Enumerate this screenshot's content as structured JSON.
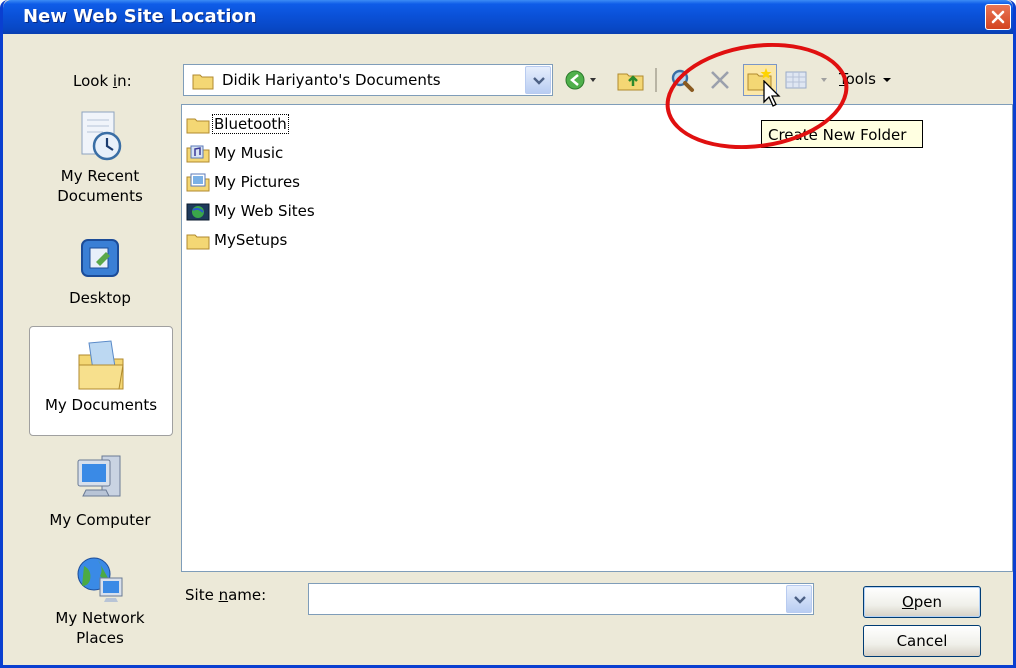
{
  "window": {
    "title": "New Web Site Location"
  },
  "lookin": {
    "label_pre": "Look ",
    "label_accel": "i",
    "label_post": "n:",
    "value": "Didik Hariyanto's Documents"
  },
  "toolbar": {
    "tools_pre": "",
    "tools_accel": "T",
    "tools_post": "ools"
  },
  "places": [
    {
      "label": "My Recent Documents",
      "icon": "recent-documents-icon"
    },
    {
      "label": "Desktop",
      "icon": "desktop-icon"
    },
    {
      "label": "My Documents",
      "icon": "my-documents-icon",
      "selected": true
    },
    {
      "label": "My Computer",
      "icon": "my-computer-icon"
    },
    {
      "label": "My Network Places",
      "icon": "network-places-icon"
    }
  ],
  "files": [
    {
      "name": "Bluetooth",
      "icon": "folder-icon"
    },
    {
      "name": "My Music",
      "icon": "music-folder-icon"
    },
    {
      "name": "My Pictures",
      "icon": "pictures-folder-icon"
    },
    {
      "name": "My Web Sites",
      "icon": "web-sites-folder-icon"
    },
    {
      "name": "MySetups",
      "icon": "folder-icon"
    }
  ],
  "tooltip": {
    "text": "Create New Folder"
  },
  "sitename": {
    "label_pre": "Site ",
    "label_accel": "n",
    "label_post": "ame:",
    "value": ""
  },
  "buttons": {
    "open_accel": "O",
    "open_post": "pen",
    "cancel": "Cancel"
  },
  "colors": {
    "titlebar": "#0a50d6",
    "dialog_bg": "#ece9d8",
    "annotation": "#e01010",
    "tooltip_bg": "#ffffe1"
  }
}
